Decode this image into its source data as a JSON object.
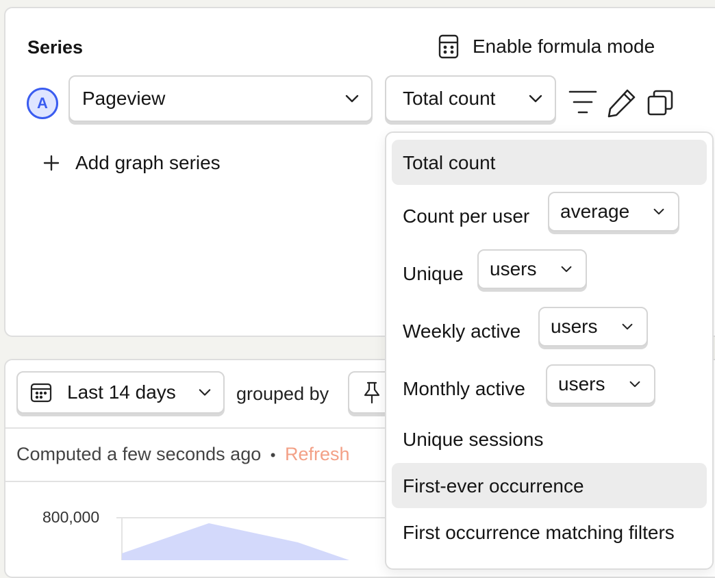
{
  "series": {
    "title": "Series",
    "formula_label": "Enable formula mode",
    "badge": "A",
    "event_value": "Pageview",
    "math_value": "Total count",
    "add_label": "Add graph series"
  },
  "results": {
    "date_range": "Last 14 days",
    "grouped_by": "grouped by",
    "computed": "Computed a few seconds ago",
    "separator": "•",
    "refresh": "Refresh",
    "y_tick": "800,000"
  },
  "menu": {
    "total_count": "Total count",
    "count_per_user": "Count per user",
    "count_per_user_value": "average",
    "unique": "Unique",
    "unique_value": "users",
    "weekly_active": "Weekly active",
    "weekly_active_value": "users",
    "monthly_active": "Monthly active",
    "monthly_active_value": "users",
    "unique_sessions": "Unique sessions",
    "first_ever": "First-ever occurrence",
    "first_matching": "First occurrence matching filters"
  },
  "colors": {
    "accent": "#3a5cf0",
    "refresh": "#f3a086",
    "chart_fill": "#d3d9fb"
  },
  "icons": [
    "calculator-icon",
    "chevron-down-icon",
    "filter-icon",
    "pencil-icon",
    "duplicate-icon",
    "plus-icon",
    "calendar-icon",
    "pin-icon"
  ]
}
